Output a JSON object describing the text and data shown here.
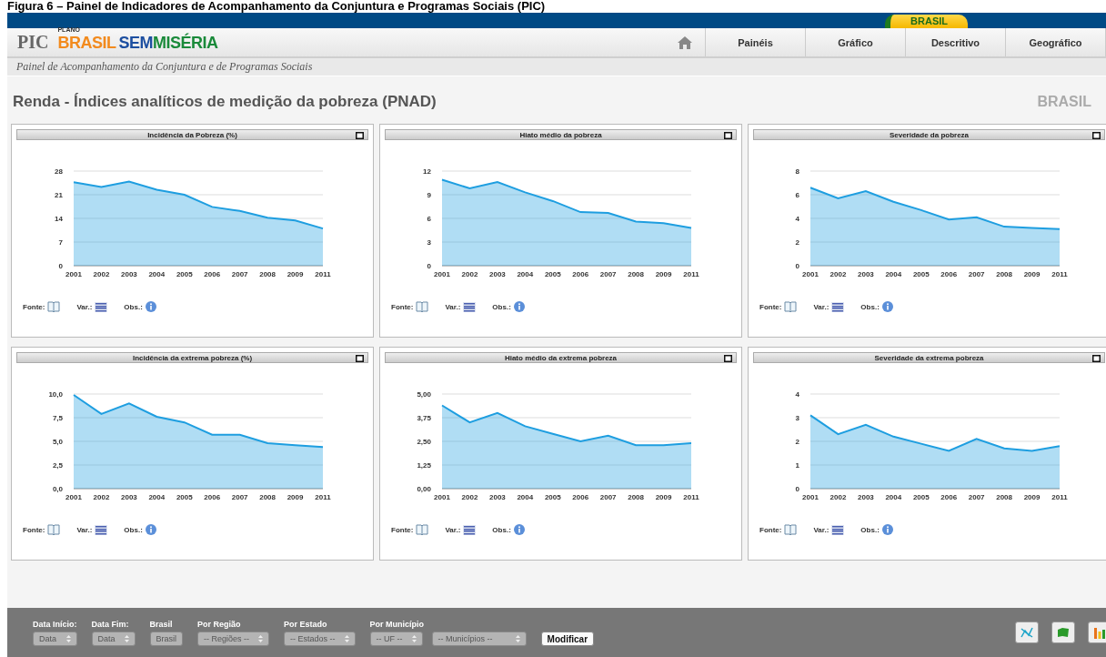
{
  "caption": "Figura 6 – Painel de Indicadores de Acompanhamento da Conjuntura e Programas Sociais (PIC)",
  "top_bar": {
    "tab": "BRASIL"
  },
  "logo": {
    "prefix": "PIC",
    "plano": "PLANO",
    "brasil": "BRASIL",
    "sem": "SEM",
    "miseria": "MISÉRIA"
  },
  "nav": [
    "Painéis",
    "Gráfico",
    "Descritivo",
    "Geográfico"
  ],
  "subtitle": "Painel de Acompanhamento da Conjuntura e de Programas Sociais",
  "page_title": "Renda - Índices analíticos de medição da pobreza (PNAD)",
  "region": "BRASIL",
  "panels": [
    {
      "title": "Incidência da Pobreza (%)",
      "chart_data": {
        "type": "area",
        "categories": [
          "2001",
          "2002",
          "2003",
          "2004",
          "2005",
          "2006",
          "2007",
          "2008",
          "2009",
          "2011"
        ],
        "ylim": [
          0,
          28
        ],
        "yticks": [
          0,
          7,
          14,
          21,
          28
        ],
        "grid": true,
        "series": [
          {
            "color": "#1e9ee0",
            "values": [
              24.7,
              23.3,
              24.9,
              22.5,
              21.0,
              17.4,
              16.2,
              14.2,
              13.4,
              11.0
            ]
          }
        ]
      },
      "fonte": "Fonte:",
      "var": "Var.:",
      "obs": "Obs.:"
    },
    {
      "title": "Hiato médio da pobreza",
      "chart_data": {
        "type": "area",
        "categories": [
          "2001",
          "2002",
          "2003",
          "2004",
          "2005",
          "2006",
          "2007",
          "2008",
          "2009",
          "2011"
        ],
        "ylim": [
          0,
          12
        ],
        "yticks": [
          0,
          3,
          6,
          9,
          12
        ],
        "grid": true,
        "series": [
          {
            "color": "#1e9ee0",
            "values": [
              10.9,
              9.8,
              10.6,
              9.3,
              8.2,
              6.8,
              6.7,
              5.6,
              5.4,
              4.8
            ]
          }
        ]
      },
      "fonte": "Fonte:",
      "var": "Var.:",
      "obs": "Obs.:"
    },
    {
      "title": "Severidade da pobreza",
      "chart_data": {
        "type": "area",
        "categories": [
          "2001",
          "2002",
          "2003",
          "2004",
          "2005",
          "2006",
          "2007",
          "2008",
          "2009",
          "2011"
        ],
        "ylim": [
          0,
          8
        ],
        "yticks": [
          0,
          2,
          4,
          6,
          8
        ],
        "grid": true,
        "series": [
          {
            "color": "#1e9ee0",
            "values": [
              6.6,
              5.7,
              6.3,
              5.4,
              4.7,
              3.9,
              4.1,
              3.3,
              3.2,
              3.1
            ]
          }
        ]
      },
      "fonte": "Fonte:",
      "var": "Var.:",
      "obs": "Obs.:"
    },
    {
      "title": "Incidência da extrema pobreza (%)",
      "chart_data": {
        "type": "area",
        "categories": [
          "2001",
          "2002",
          "2003",
          "2004",
          "2005",
          "2006",
          "2007",
          "2008",
          "2009",
          "2011"
        ],
        "ylim": [
          0,
          10
        ],
        "yticks": [
          {
            "value": 0,
            "label": "0,0"
          },
          {
            "value": 2.5,
            "label": "2,5"
          },
          {
            "value": 5,
            "label": "5,0"
          },
          {
            "value": 7.5,
            "label": "7,5"
          },
          {
            "value": 10,
            "label": "10,0"
          }
        ],
        "grid": true,
        "series": [
          {
            "color": "#1e9ee0",
            "values": [
              9.9,
              7.9,
              9.0,
              7.6,
              7.0,
              5.7,
              5.7,
              4.8,
              4.6,
              4.4
            ]
          }
        ]
      },
      "fonte": "Fonte:",
      "var": "Var.:",
      "obs": "Obs.:"
    },
    {
      "title": "Hiato médio da extrema pobreza",
      "chart_data": {
        "type": "area",
        "categories": [
          "2001",
          "2002",
          "2003",
          "2004",
          "2005",
          "2006",
          "2007",
          "2008",
          "2009",
          "2011"
        ],
        "ylim": [
          0,
          5
        ],
        "yticks": [
          {
            "value": 0,
            "label": "0,00"
          },
          {
            "value": 1.25,
            "label": "1,25"
          },
          {
            "value": 2.5,
            "label": "2,50"
          },
          {
            "value": 3.75,
            "label": "3,75"
          },
          {
            "value": 5,
            "label": "5,00"
          }
        ],
        "grid": true,
        "series": [
          {
            "color": "#1e9ee0",
            "values": [
              4.4,
              3.5,
              4.0,
              3.3,
              2.9,
              2.5,
              2.8,
              2.3,
              2.3,
              2.4
            ]
          }
        ]
      },
      "fonte": "Fonte:",
      "var": "Var.:",
      "obs": "Obs.:"
    },
    {
      "title": "Severidade da extrema pobreza",
      "chart_data": {
        "type": "area",
        "categories": [
          "2001",
          "2002",
          "2003",
          "2004",
          "2005",
          "2006",
          "2007",
          "2008",
          "2009",
          "2011"
        ],
        "ylim": [
          0,
          4
        ],
        "yticks": [
          0,
          1,
          2,
          3,
          4
        ],
        "grid": true,
        "series": [
          {
            "color": "#1e9ee0",
            "values": [
              3.1,
              2.3,
              2.7,
              2.2,
              1.9,
              1.6,
              2.1,
              1.7,
              1.6,
              1.8
            ]
          }
        ]
      },
      "fonte": "Fonte:",
      "var": "Var.:",
      "obs": "Obs.:"
    }
  ],
  "filters": [
    {
      "kind": "select",
      "label": "Data Início:",
      "value": "Data",
      "disabled": true
    },
    {
      "kind": "select",
      "label": "Data Fim:",
      "value": "Data",
      "disabled": true
    },
    {
      "kind": "button",
      "label": "Brasil",
      "value": "Brasil",
      "disabled": true
    },
    {
      "kind": "select",
      "label": "Por Região",
      "value": "-- Regiões --",
      "disabled": true
    },
    {
      "kind": "select",
      "label": "Por Estado",
      "value": "-- Estados --",
      "disabled": true
    },
    {
      "kind": "pair",
      "label": "Por Município",
      "value": "-- UF --",
      "value_2": "-- Municípios --",
      "disabled": true
    }
  ],
  "submit": "Modificar"
}
